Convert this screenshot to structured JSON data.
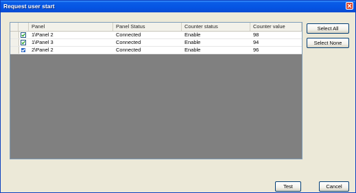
{
  "window": {
    "title": "Request user start"
  },
  "grid": {
    "columns": [
      "Panel",
      "Panel Status",
      "Counter status",
      "Counter value"
    ],
    "rows": [
      {
        "checked": true,
        "selected": false,
        "cells": [
          "1\\Panel 2",
          "Connected",
          "Enable",
          "98"
        ]
      },
      {
        "checked": true,
        "selected": false,
        "cells": [
          "1\\Panel 3",
          "Connected",
          "Enable",
          "94"
        ]
      },
      {
        "checked": true,
        "selected": true,
        "cells": [
          "2\\Panel 2",
          "Connected",
          "Enable",
          "96"
        ]
      }
    ]
  },
  "buttons": {
    "select_all": "Select All",
    "select_none": "Select None",
    "test": "Test",
    "cancel": "Cancel"
  },
  "icons": {
    "close": "close-icon",
    "checkbox": "checkmark-icon"
  },
  "colors": {
    "titlebar": "#0554e3",
    "grid_empty": "#808080",
    "selection": "#316ac5"
  }
}
